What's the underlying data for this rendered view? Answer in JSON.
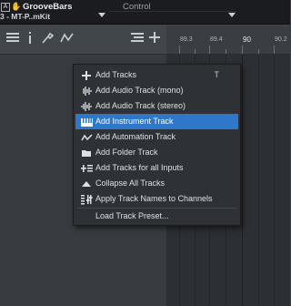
{
  "window": {
    "title": "GrooveBars",
    "instrument_name": "3 - MT-P..mKit",
    "control_label": "Control",
    "box_letter": "A"
  },
  "toolbar": {
    "icons": [
      "list-icon",
      "inspector-icon",
      "tools-icon",
      "automation-icon",
      "track-list-icon",
      "add-icon"
    ]
  },
  "ruler": {
    "labels": [
      "89.3",
      "89.4",
      "90",
      "90.2"
    ]
  },
  "menu": {
    "items": [
      {
        "label": "Add Tracks",
        "shortcut": "T",
        "icon": "plus-icon"
      },
      {
        "label": "Add Audio Track (mono)",
        "icon": "waveform-icon"
      },
      {
        "label": "Add Audio Track (stereo)",
        "icon": "waveform-icon"
      },
      {
        "label": "Add Instrument Track",
        "icon": "keyboard-icon",
        "selected": true
      },
      {
        "label": "Add Automation Track",
        "icon": "automation-icon"
      },
      {
        "label": "Add Folder Track",
        "icon": "folder-icon"
      },
      {
        "label": "Add Tracks for all Inputs",
        "icon": "add-inputs-icon"
      },
      {
        "label": "Collapse All Tracks",
        "icon": "collapse-icon"
      },
      {
        "label": "Apply Track Names to Channels",
        "icon": "channels-icon"
      },
      {
        "label": "Load Track Preset...",
        "icon": ""
      }
    ]
  },
  "colors": {
    "selection": "#2f77c9",
    "menu_bg": "#2e3236",
    "topbar_bg": "#1a1c1f"
  }
}
